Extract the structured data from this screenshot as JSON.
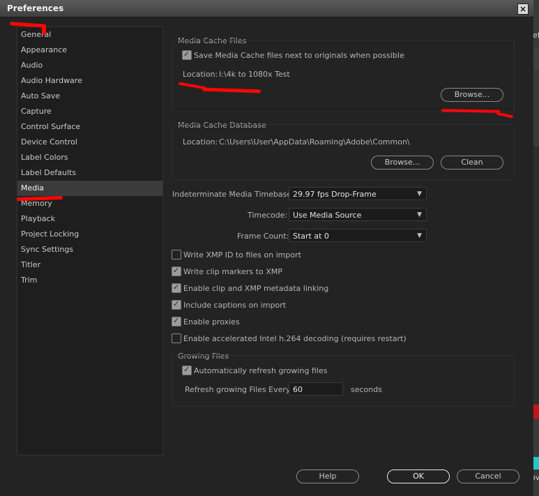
{
  "window": {
    "title": "Preferences",
    "close_glyph": "×"
  },
  "sidebar": {
    "items": [
      {
        "label": "General",
        "selected": false
      },
      {
        "label": "Appearance",
        "selected": false
      },
      {
        "label": "Audio",
        "selected": false
      },
      {
        "label": "Audio Hardware",
        "selected": false
      },
      {
        "label": "Auto Save",
        "selected": false
      },
      {
        "label": "Capture",
        "selected": false
      },
      {
        "label": "Control Surface",
        "selected": false
      },
      {
        "label": "Device Control",
        "selected": false
      },
      {
        "label": "Label Colors",
        "selected": false
      },
      {
        "label": "Label Defaults",
        "selected": false
      },
      {
        "label": "Media",
        "selected": true
      },
      {
        "label": "Memory",
        "selected": false
      },
      {
        "label": "Playback",
        "selected": false
      },
      {
        "label": "Project Locking",
        "selected": false
      },
      {
        "label": "Sync Settings",
        "selected": false
      },
      {
        "label": "Titler",
        "selected": false
      },
      {
        "label": "Trim",
        "selected": false
      }
    ]
  },
  "media_cache_files": {
    "title": "Media Cache Files",
    "save_next_label": "Save Media Cache files next to originals when possible",
    "save_next_checked": true,
    "location_label": "Location:",
    "location_value": "I:\\4k to 1080x Test",
    "browse_label": "Browse..."
  },
  "media_cache_database": {
    "title": "Media Cache Database",
    "location_label": "Location:",
    "location_value": "C:\\Users\\User\\AppData\\Roaming\\Adobe\\Common\\",
    "browse_label": "Browse...",
    "clean_label": "Clean"
  },
  "settings": {
    "timebase_label": "Indeterminate Media Timebase:",
    "timebase_value": "29.97 fps Drop-Frame",
    "timecode_label": "Timecode:",
    "timecode_value": "Use Media Source",
    "framecount_label": "Frame Count:",
    "framecount_value": "Start at 0"
  },
  "options": [
    {
      "label": "Write XMP ID to files on import",
      "checked": false
    },
    {
      "label": "Write clip markers to XMP",
      "checked": true
    },
    {
      "label": "Enable clip and XMP metadata linking",
      "checked": true
    },
    {
      "label": "Include captions on import",
      "checked": true
    },
    {
      "label": "Enable proxies",
      "checked": true
    },
    {
      "label": "Enable accelerated Intel h.264 decoding (requires restart)",
      "checked": false
    }
  ],
  "growing_files": {
    "title": "Growing Files",
    "auto_refresh_label": "Automatically refresh growing files",
    "auto_refresh_checked": true,
    "refresh_label": "Refresh growing Files Every",
    "refresh_value": "60",
    "seconds_label": "seconds"
  },
  "footer": {
    "help_label": "Help",
    "ok_label": "OK",
    "cancel_label": "Cancel"
  },
  "background_peek": {
    "text_top": "eff",
    "text_mid1": "v",
    "text_mid2": "0",
    "text_bottom": "ov"
  },
  "colors": {
    "annotation_red": "#ff0505",
    "selected_bg": "#3b3b3b"
  }
}
